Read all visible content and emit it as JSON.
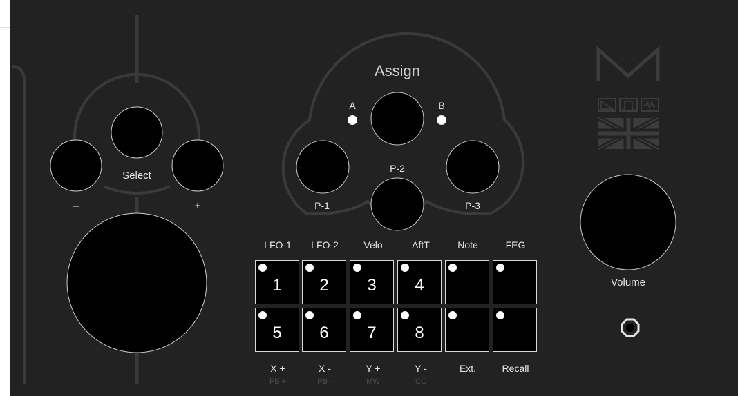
{
  "labels": {
    "assign": "Assign",
    "a": "A",
    "b": "B",
    "select": "Select",
    "minus": "–",
    "plus": "+",
    "p1": "P-1",
    "p2": "P-2",
    "p3": "P-3",
    "volume": "Volume"
  },
  "mod_labels": [
    "LFO-1",
    "LFO-2",
    "Velo",
    "AftT",
    "Note",
    "FEG"
  ],
  "pads_top": [
    "1",
    "2",
    "3",
    "4",
    "",
    ""
  ],
  "pads_bottom": [
    "5",
    "6",
    "7",
    "8",
    "",
    ""
  ],
  "bottom_labels": [
    "X +",
    "X -",
    "Y +",
    "Y -",
    "Ext.",
    "Recall"
  ],
  "sub_labels": [
    "PB +",
    "PB -",
    "MW",
    "CC"
  ],
  "colors": {
    "panel": "#222222",
    "line": "#3a3a3a",
    "led": "#ffffff",
    "knob": "#000000",
    "logo": "#3c3c3c"
  }
}
